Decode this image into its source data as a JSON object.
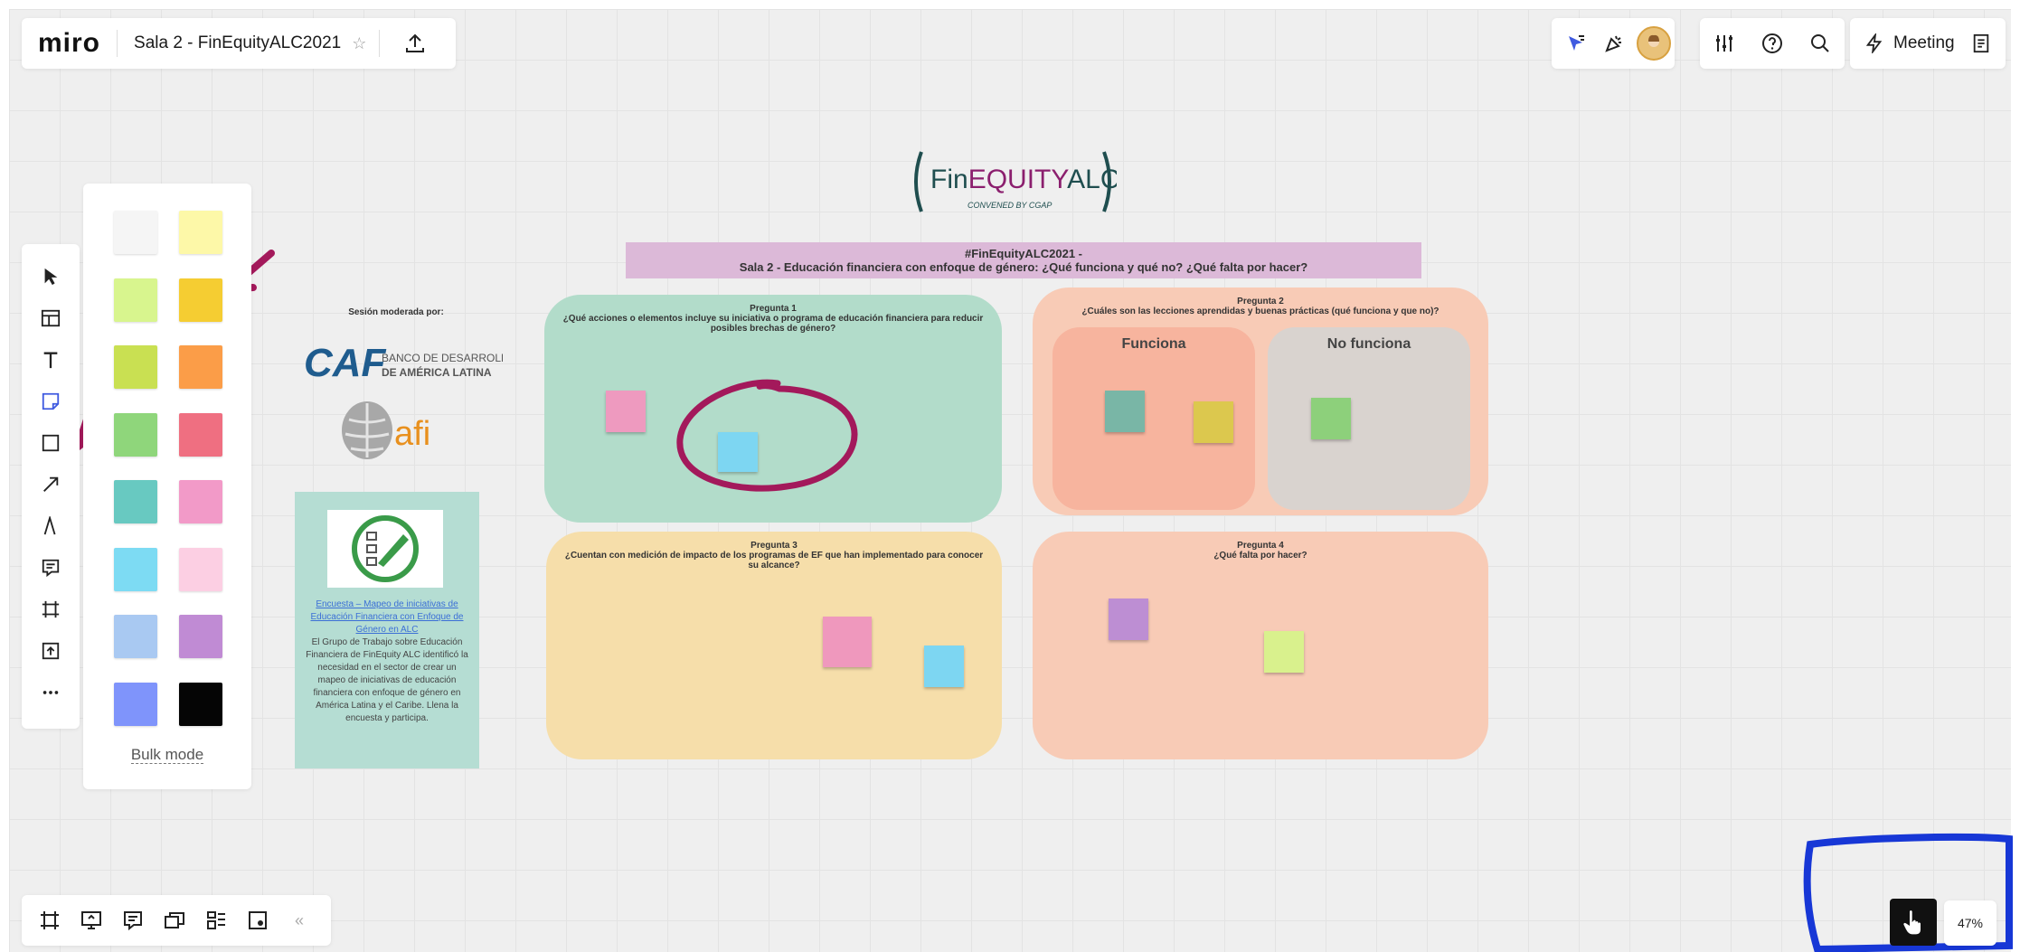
{
  "app": {
    "logo": "miro",
    "board_title": "Sala 2 - FinEquityALC2021"
  },
  "topbar": {
    "meeting_label": "Meeting"
  },
  "palette": {
    "colors": [
      "#f5f5f5",
      "#fdf8a8",
      "#d8f58e",
      "#f5cd32",
      "#c9e052",
      "#fb9d48",
      "#8fd67b",
      "#ef6f81",
      "#68c9c1",
      "#f29ac8",
      "#7ddbf3",
      "#fccfe3",
      "#a9c9f2",
      "#c08bd4",
      "#7f94fb",
      "#050505"
    ],
    "bulk_mode": "Bulk mode"
  },
  "zoom": "47%",
  "board": {
    "logo": {
      "brand_a": "Fin",
      "brand_b": "EQUITY",
      "brand_c": "ALC",
      "tagline": "CONVENED BY CGAP"
    },
    "banner": {
      "line1": "#FinEquityALC2021 -",
      "line2": "Sala 2 - Educación financiera con enfoque de género: ¿Qué funciona y qué no? ¿Qué falta por hacer?"
    },
    "moderated_by": "Sesión moderada por:",
    "caf": {
      "mark": "CAF",
      "line1": "BANCO DE DESARROLLO",
      "line2": "DE AMÉRICA LATINA"
    },
    "afi": "afi",
    "survey": {
      "link": "Encuesta – Mapeo de iniciativas de Educación Financiera con Enfoque de Género en ALC",
      "text": "El Grupo de Trabajo sobre Educación Financiera de FinEquity ALC identificó la necesidad en el sector de crear un mapeo de iniciativas de educación financiera con enfoque de género en América Latina y el Caribe. Llena la encuesta y participa."
    },
    "q1": {
      "title": "Pregunta 1",
      "text": "¿Qué acciones o elementos incluye su iniciativa o programa de educación financiera para reducir posibles brechas de género?"
    },
    "q2": {
      "title": "Pregunta 2",
      "text": "¿Cuáles son las lecciones aprendidas y buenas prácticas (qué funciona y que no)?",
      "works": "Funciona",
      "not_works": "No funciona"
    },
    "q3": {
      "title": "Pregunta 3",
      "text": "¿Cuentan con medición de impacto de los programas de EF que han implementado para conocer su alcance?"
    },
    "q4": {
      "title": "Pregunta 4",
      "text": "¿Qué falta por hacer?"
    }
  },
  "icons": [
    "cursor-icon",
    "templates-icon",
    "text-icon",
    "sticky-note-icon",
    "shape-icon",
    "arrow-icon",
    "pen-icon",
    "comment-icon",
    "frame-icon",
    "upload-icon",
    "more-icon"
  ]
}
